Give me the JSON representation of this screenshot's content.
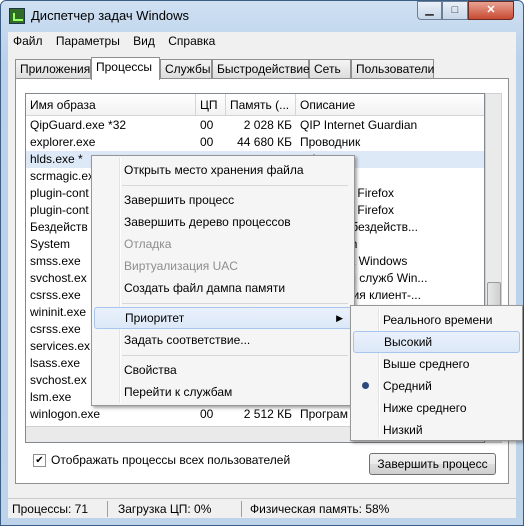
{
  "window": {
    "title": "Диспетчер задач Windows"
  },
  "menu": [
    "Файл",
    "Параметры",
    "Вид",
    "Справка"
  ],
  "tabs": [
    "Приложения",
    "Процессы",
    "Службы",
    "Быстродействие",
    "Сеть",
    "Пользователи"
  ],
  "active_tab": "Процессы",
  "columns": [
    "Имя образа",
    "ЦП",
    "Память (...",
    "Описание"
  ],
  "rows": [
    [
      "QipGuard.exe *32",
      "00",
      "2 028 КБ",
      "QIP Internet Guardian"
    ],
    [
      "explorer.exe",
      "00",
      "44 680 КБ",
      "Проводник"
    ],
    [
      "hlds.exe *",
      "",
      "",
      "ncher"
    ],
    [
      "scrmagic.ex",
      "",
      "",
      ""
    ],
    [
      "plugin-cont",
      "",
      "",
      "ntainer for Firefox"
    ],
    [
      "plugin-cont",
      "",
      "",
      "ntainer for Firefox"
    ],
    [
      "Бездейств",
      "",
      "",
      "времени бездейств..."
    ],
    [
      "System",
      "",
      "",
      "l & System"
    ],
    [
      "smss.exe",
      "",
      "",
      "ер сеанса  Windows"
    ],
    [
      "svchost.ex",
      "",
      "",
      "оцесс для служб Win..."
    ],
    [
      "csrss.exe",
      "",
      "",
      "исполнения клиент-..."
    ],
    [
      "wininit.exe",
      "",
      "",
      ""
    ],
    [
      "csrss.exe",
      "",
      "",
      ""
    ],
    [
      "services.ex",
      "",
      "",
      ""
    ],
    [
      "lsass.exe",
      "",
      "",
      ""
    ],
    [
      "svchost.ex",
      "",
      "",
      ""
    ],
    [
      "lsm.exe",
      "",
      "",
      ""
    ],
    [
      "winlogon.exe",
      "00",
      "2 512 КБ",
      "Програм"
    ]
  ],
  "show_all_users": {
    "label": "Отображать процессы всех пользователей",
    "checked": true
  },
  "end_process_button": "Завершить процесс",
  "status": {
    "processes": "Процессы: 71",
    "cpu": "Загрузка ЦП: 0%",
    "memory": "Физическая память: 58%"
  },
  "context_menu": {
    "items": [
      {
        "label": "Открыть место хранения файла"
      },
      {
        "label": "Завершить процесс"
      },
      {
        "label": "Завершить дерево процессов"
      },
      {
        "label": "Отладка",
        "disabled": true
      },
      {
        "label": "Виртуализация UAC",
        "disabled": true
      },
      {
        "label": "Создать файл дампа памяти"
      },
      {
        "label": "Приоритет",
        "submenu": true,
        "highlighted": true
      },
      {
        "label": "Задать соответствие..."
      },
      {
        "label": "Свойства"
      },
      {
        "label": "Перейти к службам"
      }
    ]
  },
  "priority_menu": {
    "items": [
      "Реального времени",
      "Высокий",
      "Выше среднего",
      "Средний",
      "Ниже среднего",
      "Низкий"
    ],
    "highlighted": "Высокий",
    "selected": "Средний"
  }
}
